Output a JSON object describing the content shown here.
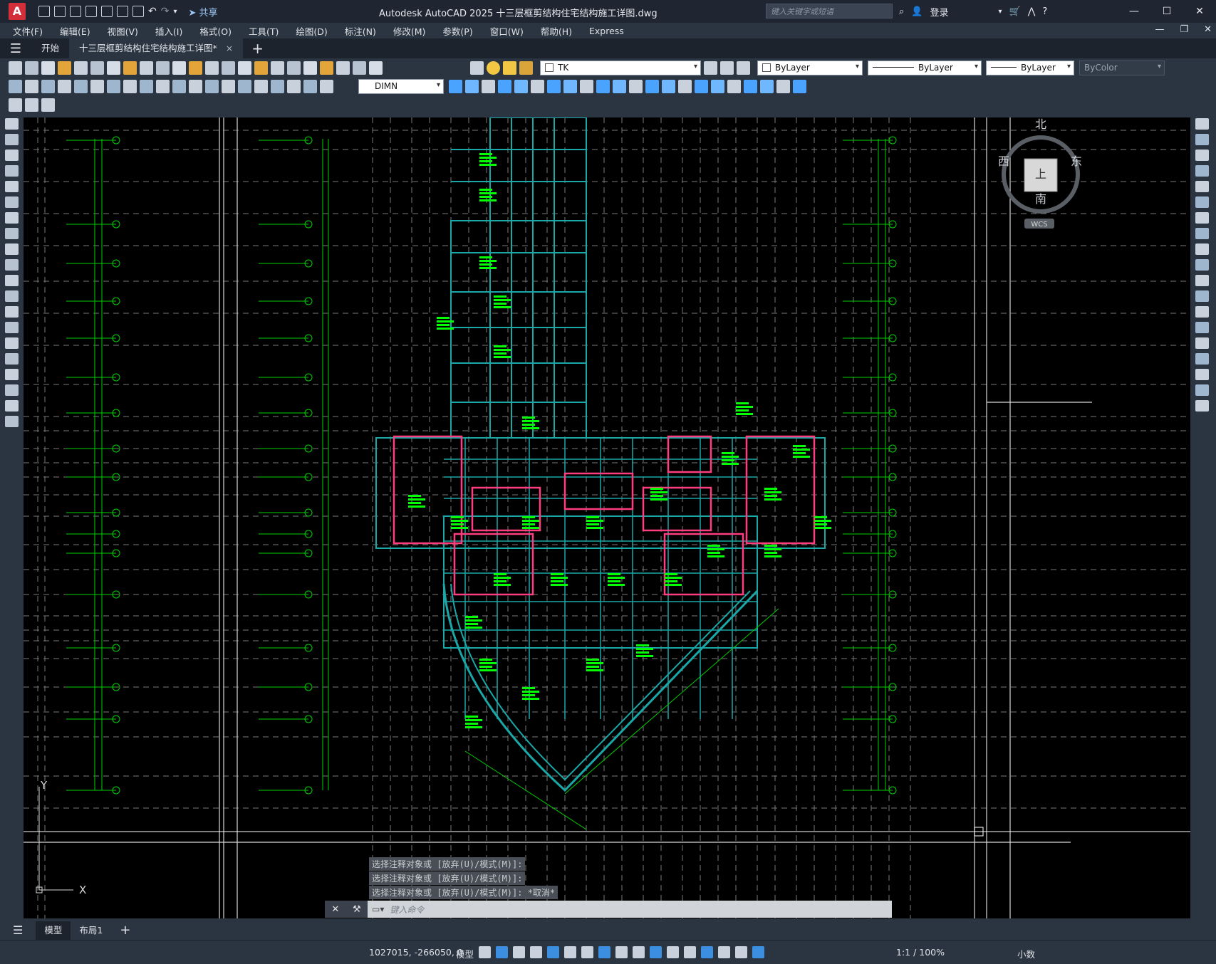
{
  "app": {
    "logo_letter": "A",
    "window_title": "Autodesk AutoCAD 2025    十三层框剪结构住宅结构施工详图.dwg",
    "share_label": "共享",
    "search_placeholder": "键入关键字或短语",
    "login_label": "登录"
  },
  "menus": [
    "文件(F)",
    "编辑(E)",
    "视图(V)",
    "插入(I)",
    "格式(O)",
    "工具(T)",
    "绘图(D)",
    "标注(N)",
    "修改(M)",
    "参数(P)",
    "窗口(W)",
    "帮助(H)",
    "Express"
  ],
  "tabs": {
    "start": "开始",
    "doc": "十三层框剪结构住宅结构施工详图*",
    "close": "×",
    "add": "+"
  },
  "toolbar": {
    "layer": "TK",
    "color": "ByLayer",
    "linetype": "ByLayer",
    "lineweight": "ByLayer",
    "plotstyle": "ByColor",
    "dimstyle": "DIMN"
  },
  "viewcube": {
    "north": "北",
    "south": "南",
    "east": "东",
    "west": "西",
    "face": "上",
    "ucs": "WCS"
  },
  "ucs_icon": {
    "x": "X",
    "y": "Y"
  },
  "command": {
    "history": [
      "选择注释对象或 [放弃(U)/模式(M)]:",
      "选择注释对象或 [放弃(U)/模式(M)]:",
      "选择注释对象或 [放弃(U)/模式(M)]: *取消*"
    ],
    "placeholder": "键入命令"
  },
  "layout_tabs": [
    "模型",
    "布局1"
  ],
  "status": {
    "coordinates": "1027015, -266050, 0",
    "space": "模型",
    "annotation_scale": "1:1 / 100%",
    "units": "小数"
  },
  "colors": {
    "grid": "#7a7a7a",
    "axis": "#00d000",
    "wall": "#1aa7a7",
    "column": "#ff3d7f",
    "annotation": "#00ff00",
    "background": "#000000"
  }
}
